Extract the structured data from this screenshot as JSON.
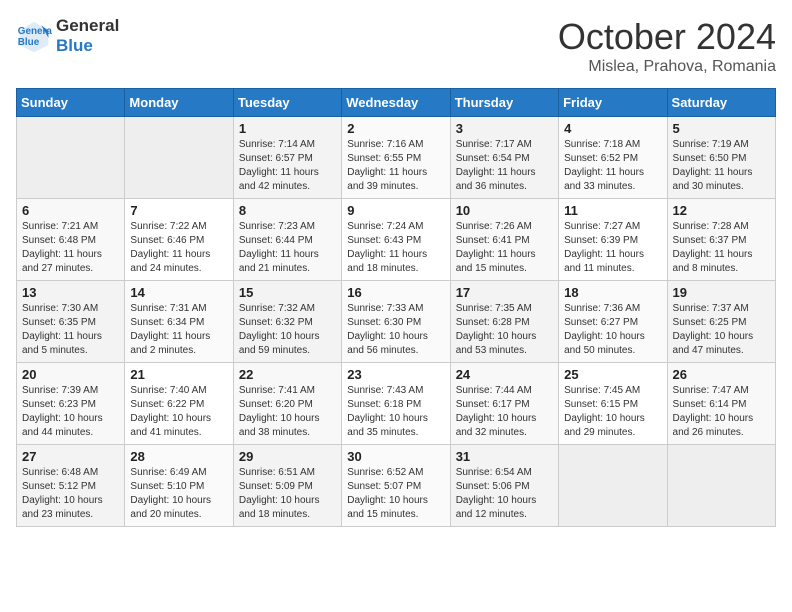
{
  "header": {
    "logo_line1": "General",
    "logo_line2": "Blue",
    "title": "October 2024",
    "subtitle": "Mislea, Prahova, Romania"
  },
  "weekdays": [
    "Sunday",
    "Monday",
    "Tuesday",
    "Wednesday",
    "Thursday",
    "Friday",
    "Saturday"
  ],
  "weeks": [
    [
      {
        "day": "",
        "empty": true
      },
      {
        "day": "",
        "empty": true
      },
      {
        "day": "1",
        "sunrise": "Sunrise: 7:14 AM",
        "sunset": "Sunset: 6:57 PM",
        "daylight": "Daylight: 11 hours and 42 minutes."
      },
      {
        "day": "2",
        "sunrise": "Sunrise: 7:16 AM",
        "sunset": "Sunset: 6:55 PM",
        "daylight": "Daylight: 11 hours and 39 minutes."
      },
      {
        "day": "3",
        "sunrise": "Sunrise: 7:17 AM",
        "sunset": "Sunset: 6:54 PM",
        "daylight": "Daylight: 11 hours and 36 minutes."
      },
      {
        "day": "4",
        "sunrise": "Sunrise: 7:18 AM",
        "sunset": "Sunset: 6:52 PM",
        "daylight": "Daylight: 11 hours and 33 minutes."
      },
      {
        "day": "5",
        "sunrise": "Sunrise: 7:19 AM",
        "sunset": "Sunset: 6:50 PM",
        "daylight": "Daylight: 11 hours and 30 minutes."
      }
    ],
    [
      {
        "day": "6",
        "sunrise": "Sunrise: 7:21 AM",
        "sunset": "Sunset: 6:48 PM",
        "daylight": "Daylight: 11 hours and 27 minutes."
      },
      {
        "day": "7",
        "sunrise": "Sunrise: 7:22 AM",
        "sunset": "Sunset: 6:46 PM",
        "daylight": "Daylight: 11 hours and 24 minutes."
      },
      {
        "day": "8",
        "sunrise": "Sunrise: 7:23 AM",
        "sunset": "Sunset: 6:44 PM",
        "daylight": "Daylight: 11 hours and 21 minutes."
      },
      {
        "day": "9",
        "sunrise": "Sunrise: 7:24 AM",
        "sunset": "Sunset: 6:43 PM",
        "daylight": "Daylight: 11 hours and 18 minutes."
      },
      {
        "day": "10",
        "sunrise": "Sunrise: 7:26 AM",
        "sunset": "Sunset: 6:41 PM",
        "daylight": "Daylight: 11 hours and 15 minutes."
      },
      {
        "day": "11",
        "sunrise": "Sunrise: 7:27 AM",
        "sunset": "Sunset: 6:39 PM",
        "daylight": "Daylight: 11 hours and 11 minutes."
      },
      {
        "day": "12",
        "sunrise": "Sunrise: 7:28 AM",
        "sunset": "Sunset: 6:37 PM",
        "daylight": "Daylight: 11 hours and 8 minutes."
      }
    ],
    [
      {
        "day": "13",
        "sunrise": "Sunrise: 7:30 AM",
        "sunset": "Sunset: 6:35 PM",
        "daylight": "Daylight: 11 hours and 5 minutes."
      },
      {
        "day": "14",
        "sunrise": "Sunrise: 7:31 AM",
        "sunset": "Sunset: 6:34 PM",
        "daylight": "Daylight: 11 hours and 2 minutes."
      },
      {
        "day": "15",
        "sunrise": "Sunrise: 7:32 AM",
        "sunset": "Sunset: 6:32 PM",
        "daylight": "Daylight: 10 hours and 59 minutes."
      },
      {
        "day": "16",
        "sunrise": "Sunrise: 7:33 AM",
        "sunset": "Sunset: 6:30 PM",
        "daylight": "Daylight: 10 hours and 56 minutes."
      },
      {
        "day": "17",
        "sunrise": "Sunrise: 7:35 AM",
        "sunset": "Sunset: 6:28 PM",
        "daylight": "Daylight: 10 hours and 53 minutes."
      },
      {
        "day": "18",
        "sunrise": "Sunrise: 7:36 AM",
        "sunset": "Sunset: 6:27 PM",
        "daylight": "Daylight: 10 hours and 50 minutes."
      },
      {
        "day": "19",
        "sunrise": "Sunrise: 7:37 AM",
        "sunset": "Sunset: 6:25 PM",
        "daylight": "Daylight: 10 hours and 47 minutes."
      }
    ],
    [
      {
        "day": "20",
        "sunrise": "Sunrise: 7:39 AM",
        "sunset": "Sunset: 6:23 PM",
        "daylight": "Daylight: 10 hours and 44 minutes."
      },
      {
        "day": "21",
        "sunrise": "Sunrise: 7:40 AM",
        "sunset": "Sunset: 6:22 PM",
        "daylight": "Daylight: 10 hours and 41 minutes."
      },
      {
        "day": "22",
        "sunrise": "Sunrise: 7:41 AM",
        "sunset": "Sunset: 6:20 PM",
        "daylight": "Daylight: 10 hours and 38 minutes."
      },
      {
        "day": "23",
        "sunrise": "Sunrise: 7:43 AM",
        "sunset": "Sunset: 6:18 PM",
        "daylight": "Daylight: 10 hours and 35 minutes."
      },
      {
        "day": "24",
        "sunrise": "Sunrise: 7:44 AM",
        "sunset": "Sunset: 6:17 PM",
        "daylight": "Daylight: 10 hours and 32 minutes."
      },
      {
        "day": "25",
        "sunrise": "Sunrise: 7:45 AM",
        "sunset": "Sunset: 6:15 PM",
        "daylight": "Daylight: 10 hours and 29 minutes."
      },
      {
        "day": "26",
        "sunrise": "Sunrise: 7:47 AM",
        "sunset": "Sunset: 6:14 PM",
        "daylight": "Daylight: 10 hours and 26 minutes."
      }
    ],
    [
      {
        "day": "27",
        "sunrise": "Sunrise: 6:48 AM",
        "sunset": "Sunset: 5:12 PM",
        "daylight": "Daylight: 10 hours and 23 minutes."
      },
      {
        "day": "28",
        "sunrise": "Sunrise: 6:49 AM",
        "sunset": "Sunset: 5:10 PM",
        "daylight": "Daylight: 10 hours and 20 minutes."
      },
      {
        "day": "29",
        "sunrise": "Sunrise: 6:51 AM",
        "sunset": "Sunset: 5:09 PM",
        "daylight": "Daylight: 10 hours and 18 minutes."
      },
      {
        "day": "30",
        "sunrise": "Sunrise: 6:52 AM",
        "sunset": "Sunset: 5:07 PM",
        "daylight": "Daylight: 10 hours and 15 minutes."
      },
      {
        "day": "31",
        "sunrise": "Sunrise: 6:54 AM",
        "sunset": "Sunset: 5:06 PM",
        "daylight": "Daylight: 10 hours and 12 minutes."
      },
      {
        "day": "",
        "empty": true
      },
      {
        "day": "",
        "empty": true
      }
    ]
  ]
}
